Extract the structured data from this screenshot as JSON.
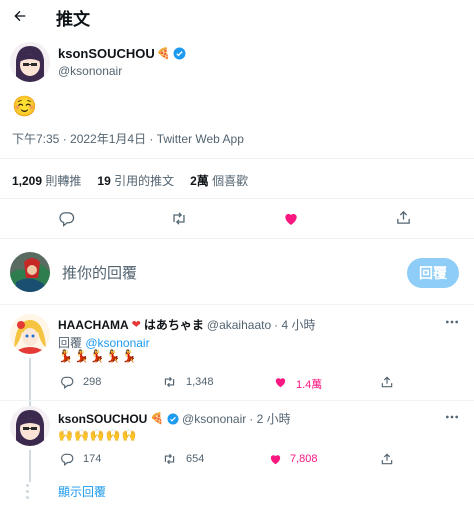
{
  "header": {
    "title": "推文"
  },
  "main_tweet": {
    "display_name": "ksonSOUCHOU",
    "name_emoji": "🍕",
    "handle": "@ksononair",
    "content": "☺️",
    "timestamp": "下午7:35 · 2022年1月4日 · Twitter Web App",
    "retweets_count": "1,209",
    "retweets_label": "則轉推",
    "quotes_count": "19",
    "quotes_label": "引用的推文",
    "likes_count": "2萬",
    "likes_label": "個喜歡"
  },
  "compose": {
    "placeholder": "推你的回覆",
    "button_label": "回覆"
  },
  "replies": [
    {
      "display_name": "HAACHAMA",
      "name_emoji": "❤",
      "name_suffix": "はあちゃま",
      "handle": "@akaihaato",
      "time": "· 4 小時",
      "reply_to_prefix": "回覆",
      "reply_to": "@ksononair",
      "content": "💃💃💃💃💃",
      "replies_count": "298",
      "retweets_count": "1,348",
      "likes_count": "1.4萬"
    },
    {
      "display_name": "ksonSOUCHOU",
      "name_emoji": "🍕",
      "handle": "@ksononair",
      "time": "· 2 小時",
      "content": "🙌🙌🙌🙌🙌",
      "replies_count": "174",
      "retweets_count": "654",
      "likes_count": "7,808"
    }
  ],
  "show_replies_label": "顯示回覆",
  "colors": {
    "accent": "#1d9bf0",
    "like": "#f91880",
    "muted": "#536471",
    "divider": "#eff3f4",
    "reply_button": "#8ecdf8"
  }
}
